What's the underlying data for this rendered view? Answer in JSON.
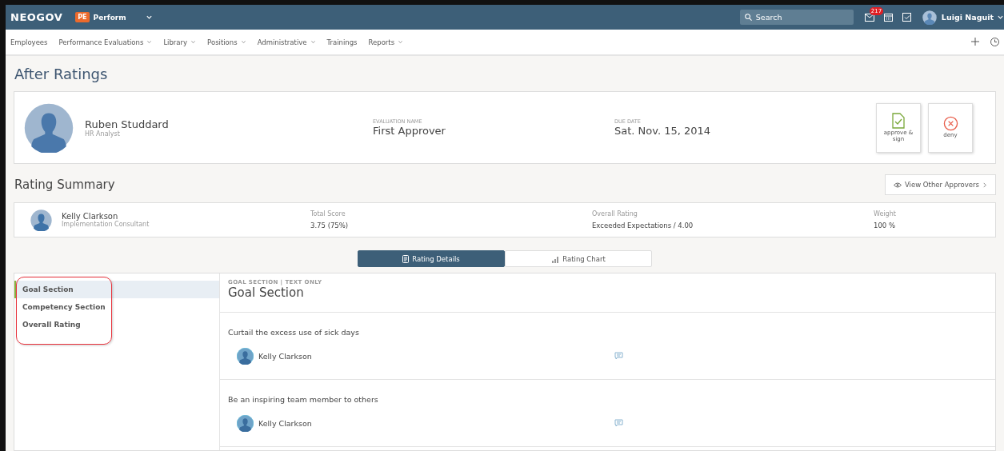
{
  "app": {
    "brand": "NEOGOV",
    "product": {
      "badge": "PE",
      "name": "Perform"
    },
    "search": {
      "placeholder": "Search"
    },
    "notifications": "217",
    "user": "Luigi Naguit"
  },
  "nav": [
    {
      "label": "Employees",
      "dropdown": false
    },
    {
      "label": "Performance Evaluations",
      "dropdown": true
    },
    {
      "label": "Library",
      "dropdown": true
    },
    {
      "label": "Positions",
      "dropdown": true
    },
    {
      "label": "Administrative",
      "dropdown": true
    },
    {
      "label": "Trainings",
      "dropdown": false
    },
    {
      "label": "Reports",
      "dropdown": true
    }
  ],
  "page_title": "After Ratings",
  "evaluation": {
    "employee": {
      "name": "Ruben Studdard",
      "role": "HR Analyst"
    },
    "fields": [
      {
        "label": "EVALUATION NAME",
        "value": "First Approver"
      },
      {
        "label": "DUE DATE",
        "value": "Sat. Nov. 15, 2014"
      }
    ],
    "actions": [
      {
        "kind": "approve",
        "label": "approve & sign"
      },
      {
        "kind": "deny",
        "label": "deny"
      }
    ]
  },
  "rating_summary": {
    "title": "Rating Summary",
    "button": "View Other Approvers",
    "rater": {
      "name": "Kelly Clarkson",
      "role": "Implementation Consultant"
    },
    "fields": [
      {
        "label": "Total Score",
        "value": "3.75 (75%)"
      },
      {
        "label": "Overall Rating",
        "value": "Exceeded Expectations / 4.00"
      },
      {
        "label": "Weight",
        "value": "100 %"
      }
    ]
  },
  "view_tabs": [
    {
      "kind": "details",
      "label": "Rating Details",
      "selected": true
    },
    {
      "kind": "chart",
      "label": "Rating Chart",
      "selected": false
    }
  ],
  "sidebar": {
    "highlighted": true,
    "items": [
      {
        "label": "Goal Section",
        "selected": true
      },
      {
        "label": "Competency Section",
        "selected": false
      },
      {
        "label": "Overall Rating",
        "selected": false
      }
    ]
  },
  "detail": {
    "eyebrow": "GOAL SECTION | TEXT ONLY",
    "title": "Goal Section",
    "goals": [
      {
        "title": "Curtail the excess use of sick days",
        "reviewer": "Kelly Clarkson"
      },
      {
        "title": "Be an inspiring team member to others",
        "reviewer": "Kelly Clarkson"
      }
    ]
  }
}
